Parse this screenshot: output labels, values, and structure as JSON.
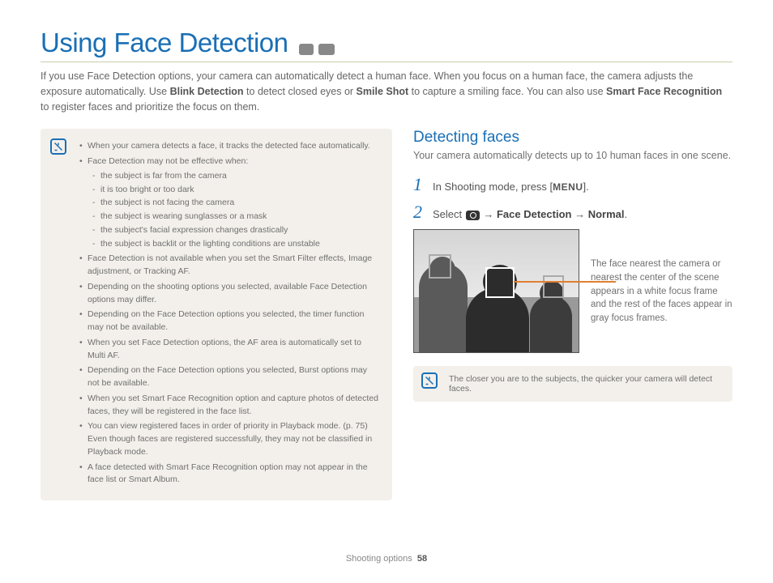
{
  "page_title": "Using Face Detection",
  "intro": {
    "part1": "If you use Face Detection options, your camera can automatically detect a human face. When you focus on a human face, the camera adjusts the exposure automatically. Use ",
    "bold1": "Blink Detection",
    "part2": " to detect closed eyes or ",
    "bold2": "Smile Shot",
    "part3": " to capture a smiling face. You can also use ",
    "bold3": "Smart Face Recognition",
    "part4": " to register faces and prioritize the focus on them."
  },
  "notes": [
    "When your camera detects a face, it tracks the detected face automatically.",
    "Face Detection may not be effective when:",
    "Face Detection is not available when you set the Smart Filter effects, Image adjustment, or Tracking AF.",
    "Depending on the shooting options you selected, available Face Detection options may differ.",
    "Depending on the Face Detection options you selected, the timer function may not be available.",
    "When you set Face Detection options, the AF area is automatically set to Multi AF.",
    "Depending on the Face Detection options you selected, Burst options may not be available.",
    "When you set Smart Face Recognition option and capture photos of detected faces, they will be registered in the face list.",
    "You can view registered faces in order of priority in Playback mode. (p. 75) Even though faces are registered successfully, they may not be classified in Playback mode.",
    "A face detected with Smart Face Recognition option may not appear in the face list or Smart Album."
  ],
  "notes_sub": [
    "the subject is far from the camera",
    "it is too bright or too dark",
    "the subject is not facing the camera",
    "the subject is wearing sunglasses or a mask",
    "the subject's facial expression changes drastically",
    "the subject is backlit or the lighting conditions are unstable"
  ],
  "section": {
    "heading": "Detecting faces",
    "desc": "Your camera automatically detects up to 10 human faces in one scene."
  },
  "steps": {
    "s1_a": "In Shooting mode, press [",
    "s1_menu": "MENU",
    "s1_b": "].",
    "s2_a": "Select ",
    "s2_b": " → ",
    "s2_fd": "Face Detection",
    "s2_c": " → ",
    "s2_normal": "Normal",
    "s2_d": "."
  },
  "callout": "The face nearest the camera or nearest the center of the scene appears in a white focus frame and the rest of the faces appear in gray focus frames.",
  "tip": "The closer you are to the subjects, the quicker your camera will detect faces.",
  "footer": {
    "section": "Shooting options",
    "page": "58"
  },
  "step_numbers": {
    "one": "1",
    "two": "2"
  }
}
